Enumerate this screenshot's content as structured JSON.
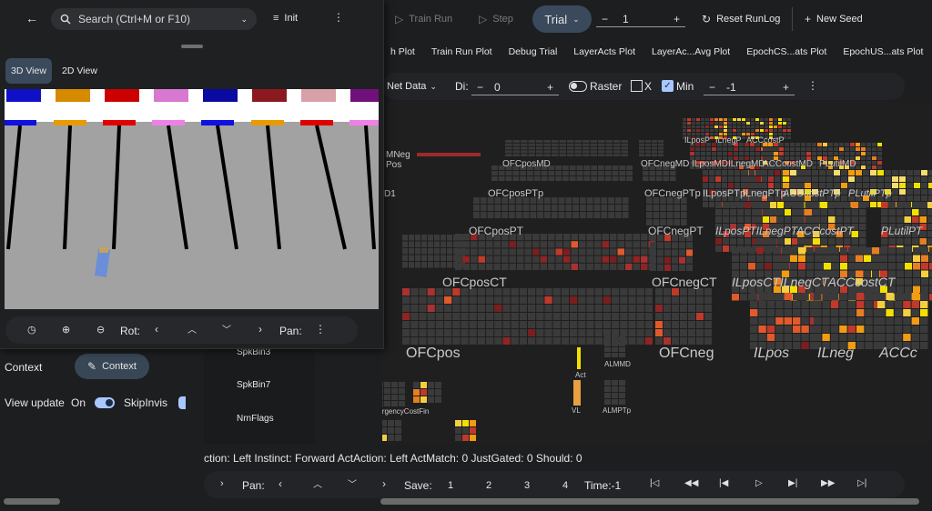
{
  "toolbar": {
    "train_run": "Train Run",
    "step": "Step",
    "trial_mode": "Trial",
    "trial_value": "1",
    "reset_runlog": "Reset RunLog",
    "new_seed": "New Seed",
    "colors": {
      "accent": "#a9c7ff",
      "pill": "#3a4a5c"
    }
  },
  "tabs": [
    "h Plot",
    "Train Run Plot",
    "Debug Trial",
    "LayerActs Plot",
    "LayerAc...Avg Plot",
    "EpochCS...ats Plot",
    "EpochUS...ats Plot"
  ],
  "netview_bar": {
    "net_data": "Net Data",
    "di_label": "Di:",
    "di_value": "0",
    "raster_label": "Raster",
    "x_label": "X",
    "min_label": "Min",
    "min_value": "-1"
  },
  "panel": {
    "search_placeholder": "Search (Ctrl+M or F10)",
    "init_label": "Init",
    "view_3d": "3D View",
    "view_2d": "2D View",
    "rot_label": "Rot:",
    "pan_label": "Pan:"
  },
  "left": {
    "context_label": "Context",
    "context_button": "Context",
    "view_update_label": "View update",
    "view_update_value": "On",
    "skip_invis_label": "SkipInvis"
  },
  "layer_list": [
    "SpkBin3",
    "SpkBin7",
    "NrnFlags"
  ],
  "net_labels": {
    "mneg": "MNeg",
    "pos": "Pos",
    "d1": "D1",
    "ofcposmd": "OFCposMD",
    "ofcposptp": "OFCposPTp",
    "ofcpospt": "OFCposPT",
    "ofcposct": "OFCposCT",
    "ofcpos": "OFCpos",
    "ofcnegmd": "OFCnegMD",
    "ofcnegptp": "OFCnegPTp",
    "ofcnegpt": "OFCnegPT",
    "ofcnegct": "OFCnegCT",
    "ofcneg": "OFCneg",
    "ilposp": "ILposP",
    "ilnegp": "ILnegP",
    "acccostp": "ACCcostP",
    "ilposmd": "ILposMD",
    "ilnegmd": "ILnegMD",
    "acccostmd": "ACCcostMD",
    "plutilmd": "PLutilMD",
    "ilposptp": "ILposPTp",
    "ilnegptp": "ILnegPTp",
    "acccostptp": "ACCcostPTp",
    "plutilptp": "PLutilPTp",
    "ilpospt": "ILposPTILnegPTACCcostPT",
    "plutilpt": "PLutilPT",
    "ilposct": "ILposCTILnegCTACCcostCT",
    "ilpos": "ILpos",
    "ilneg": "ILneg",
    "acc": "ACCc",
    "act": "Act",
    "vl": "VL",
    "almmd": "ALMMD",
    "almptp": "ALMPTp",
    "urgency": "UrgencyCostFin"
  },
  "status_text": "ction: Left Instinct: Forward ActAction: Left ActMatch: 0 JustGated: 0 Should: 0",
  "bottom": {
    "pan_label": "Pan:",
    "save_label": "Save:",
    "save_slots": [
      "1",
      "2",
      "3",
      "4"
    ],
    "time_label": "Time:-1"
  },
  "scene": {
    "flag_colors": [
      "#1010c8",
      "#d68a00",
      "#cc0000",
      "#d878d0",
      "#0a0aa0",
      "#8a1a20",
      "#d8a0a8",
      "#70107a"
    ],
    "bar_colors": [
      "#1010e0",
      "#e89a00",
      "#e00000",
      "#f080e8",
      "#1010e0",
      "#e89a00",
      "#e00000",
      "#f080e8"
    ]
  }
}
